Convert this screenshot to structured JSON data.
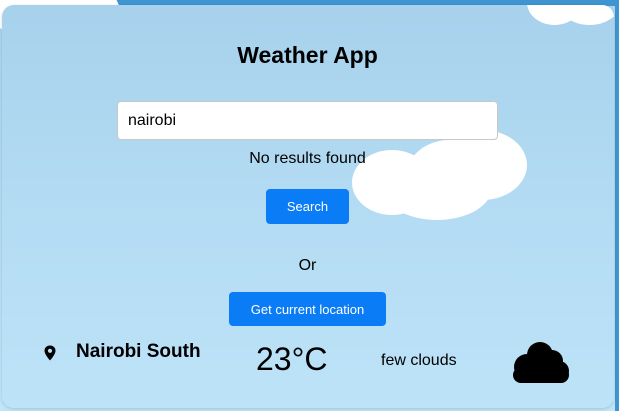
{
  "app": {
    "title": "Weather App"
  },
  "search": {
    "value": "nairobi",
    "placeholder": "",
    "status": "No results found",
    "button_label": "Search"
  },
  "divider_text": "Or",
  "location_button_label": "Get current location",
  "weather": {
    "location_icon": "map-pin-icon",
    "city": "Nairobi South",
    "temperature": "23°C",
    "description": "few clouds",
    "condition_icon": "cloud-icon"
  },
  "colors": {
    "accent": "#0a7cf5",
    "background": "#b3dbf3"
  }
}
